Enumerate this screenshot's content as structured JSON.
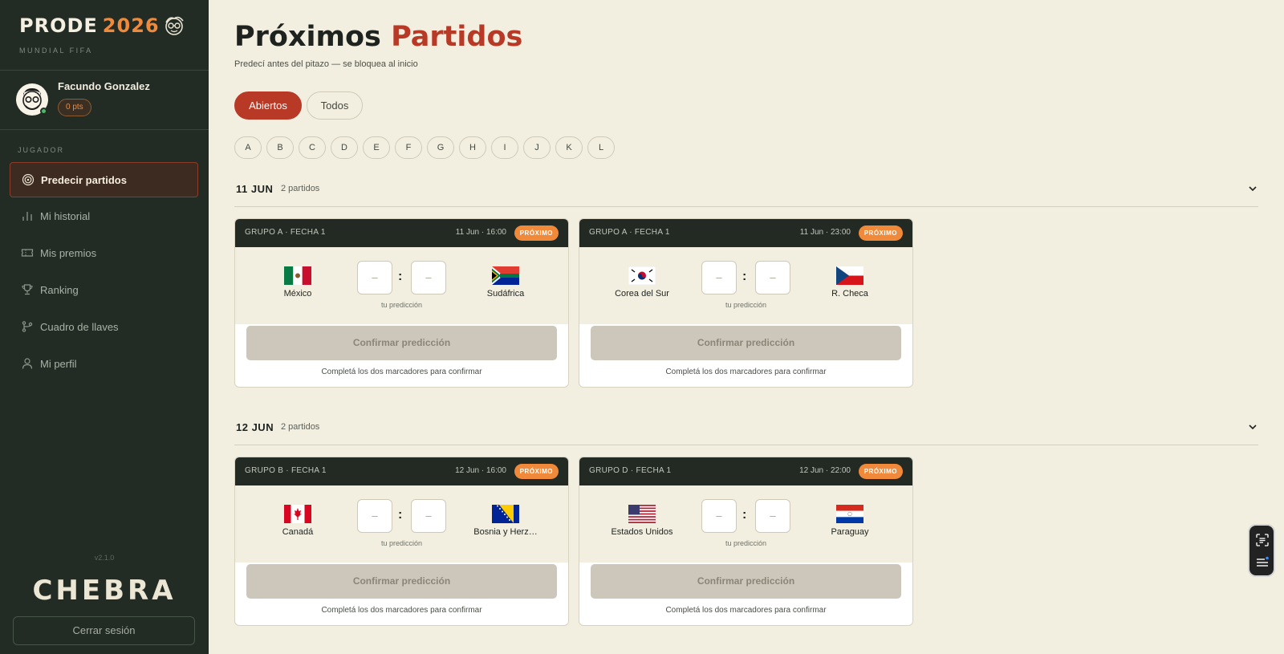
{
  "brand": {
    "name": "PRODE",
    "year": "2026",
    "subtitle": "MUNDIAL FIFA"
  },
  "user": {
    "name": "Facundo Gonzalez",
    "points": "0 pts"
  },
  "sidebar": {
    "section_label": "JUGADOR",
    "items": [
      {
        "label": "Predecir partidos",
        "icon": "target-icon",
        "active": true
      },
      {
        "label": "Mi historial",
        "icon": "bar-chart-icon",
        "active": false
      },
      {
        "label": "Mis premios",
        "icon": "ticket-icon",
        "active": false
      },
      {
        "label": "Ranking",
        "icon": "trophy-icon",
        "active": false
      },
      {
        "label": "Cuadro de llaves",
        "icon": "bracket-icon",
        "active": false
      },
      {
        "label": "Mi perfil",
        "icon": "user-icon",
        "active": false
      }
    ],
    "version": "v2.1.0",
    "footer_logo": "CHEBRA",
    "logout_label": "Cerrar sesión"
  },
  "main": {
    "title_part1": "Próximos",
    "title_part2": "Partidos",
    "subtitle": "Predecí antes del pitazo — se bloquea al inicio",
    "filters": {
      "abiertos": "Abiertos",
      "todos": "Todos",
      "selected": "Abiertos"
    },
    "groups": [
      "A",
      "B",
      "C",
      "D",
      "E",
      "F",
      "G",
      "H",
      "I",
      "J",
      "K",
      "L"
    ]
  },
  "days": [
    {
      "date": "11 JUN",
      "count": "2 partidos",
      "matches": [
        {
          "group": "GRUPO A · FECHA 1",
          "time": "11 Jun · 16:00",
          "status": "PRÓXIMO",
          "home": "México",
          "away": "Sudáfrica",
          "home_flag": "flag-mexico-icon",
          "away_flag": "flag-south-africa-icon",
          "home_score_placeholder": "–",
          "away_score_placeholder": "–"
        },
        {
          "group": "GRUPO A · FECHA 1",
          "time": "11 Jun · 23:00",
          "status": "PRÓXIMO",
          "home": "Corea del Sur",
          "away": "R. Checa",
          "home_flag": "flag-south-korea-icon",
          "away_flag": "flag-czech-icon",
          "home_score_placeholder": "–",
          "away_score_placeholder": "–"
        }
      ]
    },
    {
      "date": "12 JUN",
      "count": "2 partidos",
      "matches": [
        {
          "group": "GRUPO B · FECHA 1",
          "time": "12 Jun · 16:00",
          "status": "PRÓXIMO",
          "home": "Canadá",
          "away": "Bosnia y Herz…",
          "home_flag": "flag-canada-icon",
          "away_flag": "flag-bosnia-icon",
          "home_score_placeholder": "–",
          "away_score_placeholder": "–"
        },
        {
          "group": "GRUPO D · FECHA 1",
          "time": "12 Jun · 22:00",
          "status": "PRÓXIMO",
          "home": "Estados Unidos",
          "away": "Paraguay",
          "home_flag": "flag-usa-icon",
          "away_flag": "flag-paraguay-icon",
          "home_score_placeholder": "–",
          "away_score_placeholder": "–"
        }
      ]
    }
  ],
  "card_text": {
    "your_prediction": "tu predicción",
    "confirm": "Confirmar predicción",
    "hint": "Completá los dos marcadores para confirmar"
  },
  "colors": {
    "accent": "#b83a26",
    "orange": "#f08a3a",
    "sidebar_bg": "#222b24",
    "page_bg": "#f3efe0"
  }
}
